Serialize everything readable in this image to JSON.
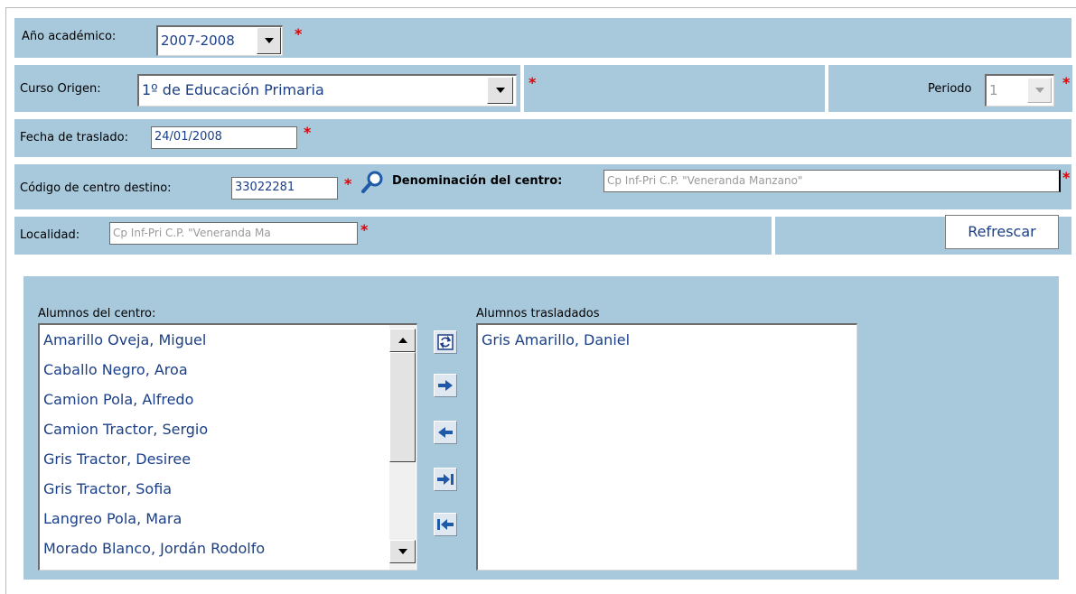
{
  "form": {
    "anio_label": "Año académico:",
    "anio_value": "2007-2008",
    "curso_label": "Curso Origen:",
    "curso_value": "1º de Educación Primaria",
    "periodo_label": "Periodo",
    "periodo_value": "1",
    "fecha_label": "Fecha de traslado:",
    "fecha_value": "24/01/2008",
    "codigo_label": "Código de centro destino:",
    "codigo_value": "33022281",
    "denominacion_label": "Denominación del centro:",
    "denominacion_value": "Cp Inf-Pri C.P. \"Veneranda Manzano\"",
    "localidad_label": "Localidad:",
    "localidad_value": "Cp Inf-Pri C.P. \"Veneranda Ma",
    "refrescar_label": "Refrescar",
    "required_mark": "*"
  },
  "alumnos_centro": {
    "label": "Alumnos del centro:",
    "items": [
      "Amarillo Oveja, Miguel",
      "Caballo Negro, Aroa",
      "Camion Pola, Alfredo",
      "Camion Tractor, Sergio",
      "Gris Tractor, Desiree",
      "Gris Tractor, Sofia",
      "Langreo Pola, Mara",
      "Morado Blanco, Jordán Rodolfo"
    ]
  },
  "alumnos_trasladados": {
    "label": "Alumnos trasladados",
    "items": [
      "Gris Amarillo, Daniel"
    ]
  },
  "transfer_buttons": [
    "swap-icon",
    "arrow-right-icon",
    "arrow-left-icon",
    "move-all-right-icon",
    "move-all-left-icon"
  ],
  "colors": {
    "band": "#a8c8dc",
    "accent_text": "#1b3f86",
    "required": "#e00000"
  }
}
